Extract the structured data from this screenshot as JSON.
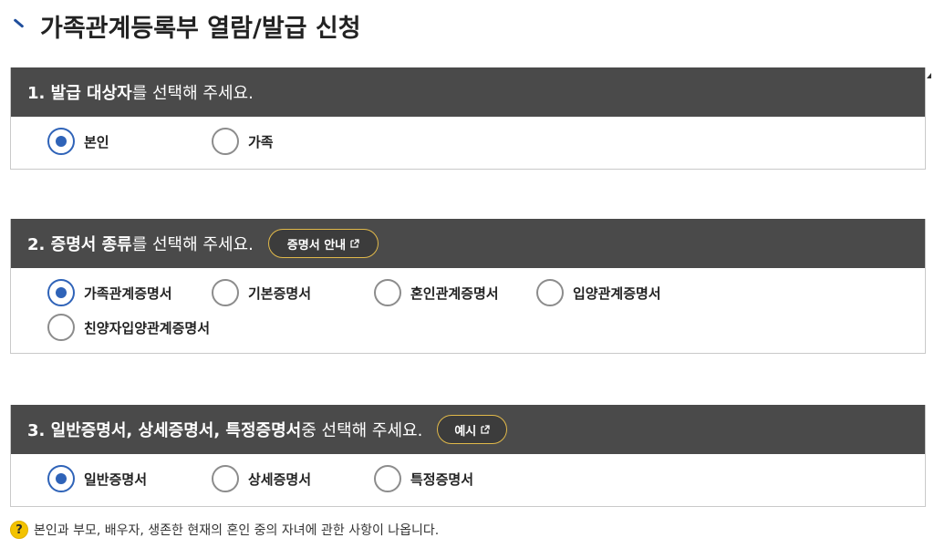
{
  "page": {
    "title": "가족관계등록부 열람/발급 신청"
  },
  "sections": [
    {
      "heading_strong": "1. 발급 대상자",
      "heading_rest": "를 선택해 주세요.",
      "options": [
        {
          "label": "본인",
          "checked": true
        },
        {
          "label": "가족",
          "checked": false
        }
      ]
    },
    {
      "heading_strong": "2. 증명서 종류",
      "heading_rest": "를 선택해 주세요.",
      "button_label": "증명서 안내",
      "options": [
        {
          "label": "가족관계증명서",
          "checked": true
        },
        {
          "label": "기본증명서",
          "checked": false
        },
        {
          "label": "혼인관계증명서",
          "checked": false
        },
        {
          "label": "입양관계증명서",
          "checked": false
        },
        {
          "label": "친양자입양관계증명서",
          "checked": false
        }
      ]
    },
    {
      "heading_strong": "3. 일반증명서, 상세증명서, 특정증명서",
      "heading_rest": " 중 선택해 주세요.",
      "button_label": "예시",
      "options": [
        {
          "label": "일반증명서",
          "checked": true
        },
        {
          "label": "상세증명서",
          "checked": false
        },
        {
          "label": "특정증명서",
          "checked": false
        }
      ]
    }
  ],
  "help": {
    "icon": "question-icon",
    "glyph": "?",
    "text": "본인과 부모, 배우자, 생존한 현재의 혼인 중의 자녀에 관한 사항이 나옵니다."
  },
  "colors": {
    "header_bg": "#4a4a4a",
    "radio_checked": "#2f63b8",
    "button_border": "#e1b94a",
    "help_icon": "#f3c300"
  }
}
